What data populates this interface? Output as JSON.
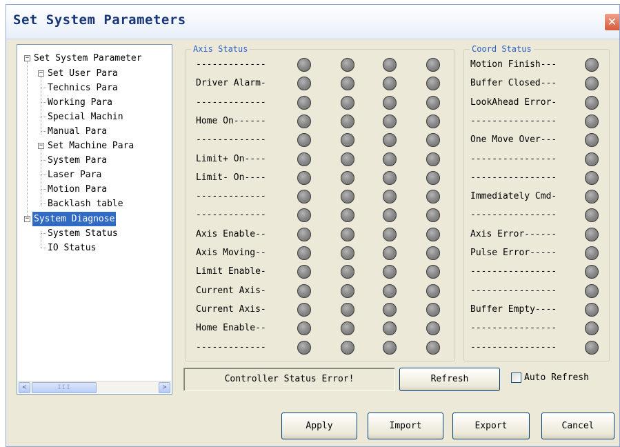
{
  "window": {
    "title": "Set System Parameters",
    "close_glyph": "✕"
  },
  "tree": {
    "items": [
      {
        "label": "Set System Parameter",
        "toggle": "−"
      },
      {
        "label": "Set User Para",
        "toggle": "−"
      },
      {
        "label": "Technics Para"
      },
      {
        "label": "Working Para"
      },
      {
        "label": "Special Machin"
      },
      {
        "label": "Manual Para"
      },
      {
        "label": "Set Machine Para",
        "toggle": "−"
      },
      {
        "label": "System Para"
      },
      {
        "label": "Laser Para"
      },
      {
        "label": "Motion Para"
      },
      {
        "label": "Backlash table"
      },
      {
        "label": "System Diagnose",
        "toggle": "−",
        "selected": true
      },
      {
        "label": "System Status"
      },
      {
        "label": "IO Status"
      }
    ],
    "scroll_left": "<",
    "scroll_right": ">",
    "scroll_grip": "III"
  },
  "axis_status": {
    "title": "Axis Status",
    "rows": [
      "-------------",
      "Driver Alarm-",
      "-------------",
      "Home On------",
      "-------------",
      "Limit+ On----",
      "Limit- On----",
      "-------------",
      "-------------",
      "Axis Enable--",
      "Axis Moving--",
      "Limit Enable-",
      "Current Axis-",
      "Current Axis-",
      "Home Enable--",
      "-------------"
    ]
  },
  "coord_status": {
    "title": "Coord Status",
    "rows": [
      "Motion Finish---",
      "Buffer Closed---",
      "LookAhead Error-",
      "----------------",
      "One Move Over---",
      "----------------",
      "----------------",
      "Immediately Cmd-",
      "----------------",
      "Axis Error------",
      "Pulse Error-----",
      "----------------",
      "----------------",
      "Buffer Empty----",
      "----------------",
      "----------------"
    ]
  },
  "status": {
    "message": "Controller Status Error!",
    "refresh_label": "Refresh",
    "auto_refresh_label": "Auto Refresh",
    "auto_refresh_checked": false
  },
  "footer": {
    "apply_label": "Apply",
    "import_label": "Import",
    "export_label": "Export",
    "cancel_label": "Cancel"
  },
  "colors": {
    "title_text": "#18357a",
    "group_label": "#2a5fc8",
    "selection": "#316ac5",
    "led_off": "#8c8c8c"
  }
}
